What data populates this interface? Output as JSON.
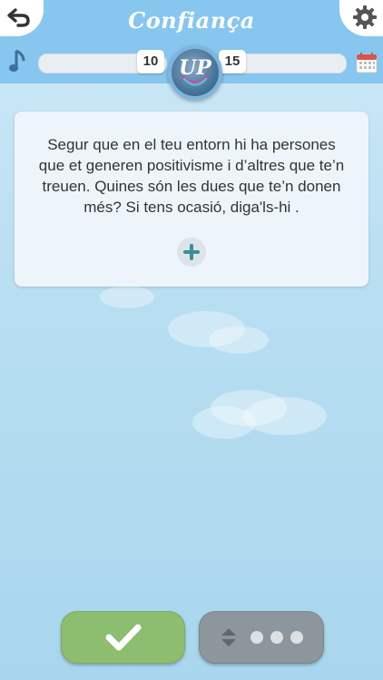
{
  "header": {
    "title": "Confiança",
    "back_icon": "back-arrow-icon",
    "settings_icon": "gear-icon",
    "music_icon": "music-note-icon",
    "calendar_icon": "calendar-icon"
  },
  "progress": {
    "level_left": "10",
    "level_right": "15",
    "badge_label": "UP"
  },
  "card": {
    "text": "Segur que en el teu entorn hi ha persones que et generen positivisme i d’altres que te’n treuen. Quines són les dues que te’n donen més? Si tens ocasió, diga'ls-hi .",
    "add_icon": "plus-icon"
  },
  "footer": {
    "confirm_icon": "checkmark-icon",
    "more_icon": "more-options-icon"
  },
  "colors": {
    "header_bg": "#87c6ee",
    "confirm_bg": "#8dbd6e",
    "more_bg": "#8c969c",
    "accent_teal": "#3a8f95"
  }
}
